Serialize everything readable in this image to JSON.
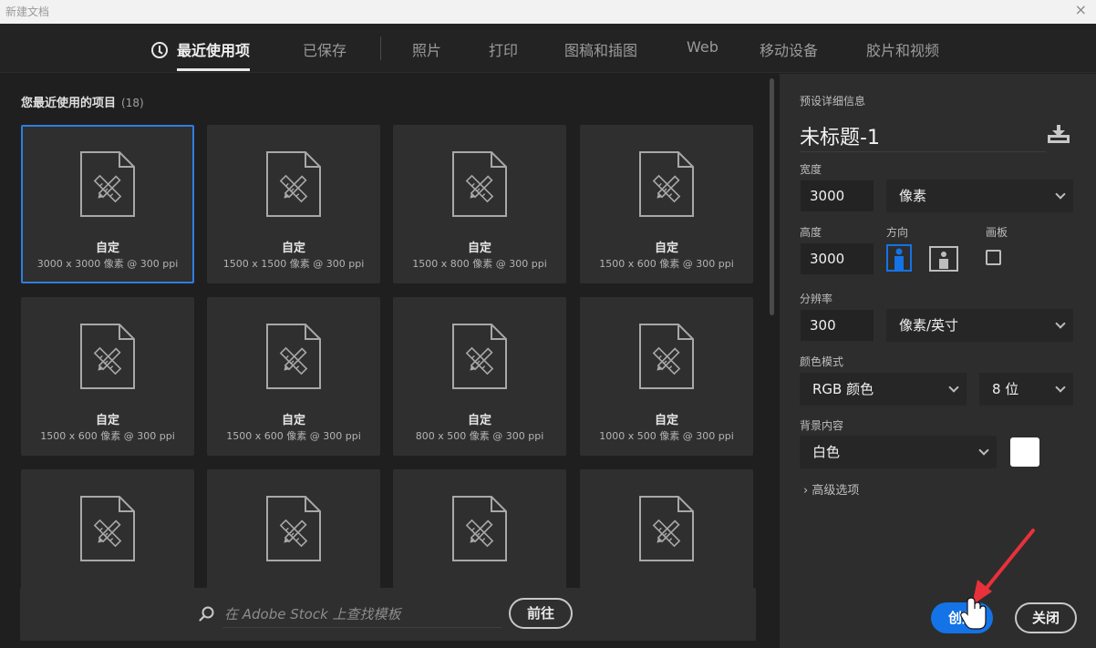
{
  "window": {
    "title": "新建文档",
    "close_glyph": "×"
  },
  "tabs": [
    {
      "label": "最近使用项",
      "active": true
    },
    {
      "label": "已保存"
    },
    {
      "label": "照片"
    },
    {
      "label": "打印"
    },
    {
      "label": "图稿和插图"
    },
    {
      "label": "Web"
    },
    {
      "label": "移动设备"
    },
    {
      "label": "胶片和视频"
    }
  ],
  "recent": {
    "heading": "您最近使用的项目",
    "count": "(18)",
    "items": [
      {
        "name": "自定",
        "dims": "3000 x 3000 像素 @ 300 ppi",
        "selected": true
      },
      {
        "name": "自定",
        "dims": "1500 x 1500 像素 @ 300 ppi"
      },
      {
        "name": "自定",
        "dims": "1500 x 800 像素 @ 300 ppi"
      },
      {
        "name": "自定",
        "dims": "1500 x 600 像素 @ 300 ppi"
      },
      {
        "name": "自定",
        "dims": "1500 x 600 像素 @ 300 ppi"
      },
      {
        "name": "自定",
        "dims": "1500 x 600 像素 @ 300 ppi"
      },
      {
        "name": "自定",
        "dims": "800 x 500 像素 @ 300 ppi"
      },
      {
        "name": "自定",
        "dims": "1000 x 500 像素 @ 300 ppi"
      },
      {
        "name": "",
        "dims": ""
      },
      {
        "name": "",
        "dims": ""
      },
      {
        "name": "",
        "dims": ""
      },
      {
        "name": "",
        "dims": ""
      }
    ]
  },
  "stock": {
    "placeholder": "在 Adobe Stock 上查找模板",
    "go_label": "前往"
  },
  "preset": {
    "section_label": "预设详细信息",
    "doc_name": "未标题-1",
    "width_label": "宽度",
    "width_value": "3000",
    "width_unit": "像素",
    "height_label": "高度",
    "height_value": "3000",
    "orientation_label": "方向",
    "artboard_label": "画板",
    "resolution_label": "分辨率",
    "resolution_value": "300",
    "resolution_unit": "像素/英寸",
    "color_mode_label": "颜色模式",
    "color_mode": "RGB 颜色",
    "bit_depth": "8 位",
    "background_label": "背景内容",
    "background": "白色",
    "background_swatch": "#ffffff",
    "advanced": "高级选项",
    "create_label": "创建",
    "close_label": "关闭"
  },
  "colors": {
    "accent": "#1473e6",
    "selected_border": "#2d7ee0",
    "annotation_arrow": "#e8313a"
  }
}
